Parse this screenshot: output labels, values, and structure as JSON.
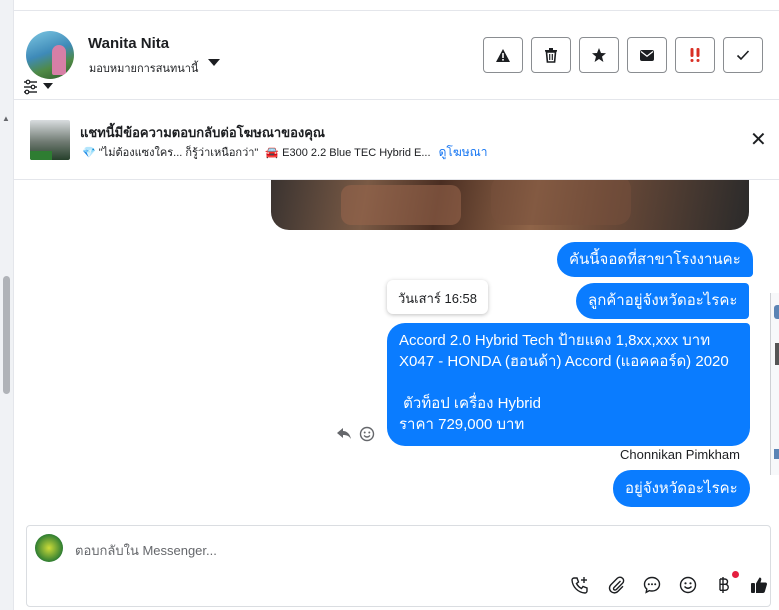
{
  "contact": {
    "name": "Wanita Nita",
    "assign_label": "มอบหมายการสนทนานี้"
  },
  "header_actions": [
    {
      "name": "report-spam-button",
      "icon": "warning-icon"
    },
    {
      "name": "delete-button",
      "icon": "trash-icon"
    },
    {
      "name": "star-button",
      "icon": "star-icon"
    },
    {
      "name": "mark-unread-button",
      "icon": "envelope-icon"
    },
    {
      "name": "follow-up-button",
      "icon": "double-exclamation-icon"
    },
    {
      "name": "mark-done-button",
      "icon": "check-icon"
    }
  ],
  "ad_banner": {
    "title": "แชทนี้มีข้อความตอบกลับต่อโฆษณาของคุณ",
    "ad_caption": "\"ไม่ต้องแซงใคร... ก็รู้ว่าเหนือกว่า\"",
    "ad_model": "E300 2.2 Blue TEC Hybrid E...",
    "view_ad_link": "ดูโฆษณา"
  },
  "messages": [
    {
      "text": "คันนี้จอดที่สาขาโรงงานคะ"
    },
    {
      "text": "ลูกค้าอยู่จังหวัดอะไรคะ"
    },
    {
      "text": "Accord 2.0 Hybrid Tech ป้ายแดง 1,8xx,xxx บาท\nX047 - HONDA (ฮอนด้า) Accord (แอคคอร์ด) 2020\n\n ตัวท็อป เครื่อง Hybrid\nราคา 729,000 บาท"
    },
    {
      "text": "อยู่จังหวัดอะไรคะ"
    }
  ],
  "tooltip": {
    "timestamp": "วันเสาร์ 16:58"
  },
  "sender_label": "Chonnikan Pimkham",
  "composer": {
    "placeholder": "ตอบกลับใน Messenger...",
    "tools": [
      "call-add-icon",
      "paperclip-icon",
      "saved-reply-icon",
      "emoji-icon",
      "currency-icon",
      "thumbs-up-icon"
    ]
  },
  "colors": {
    "bubble": "#0a7cff",
    "link": "#1877f2",
    "notification": "#e41e3f"
  }
}
